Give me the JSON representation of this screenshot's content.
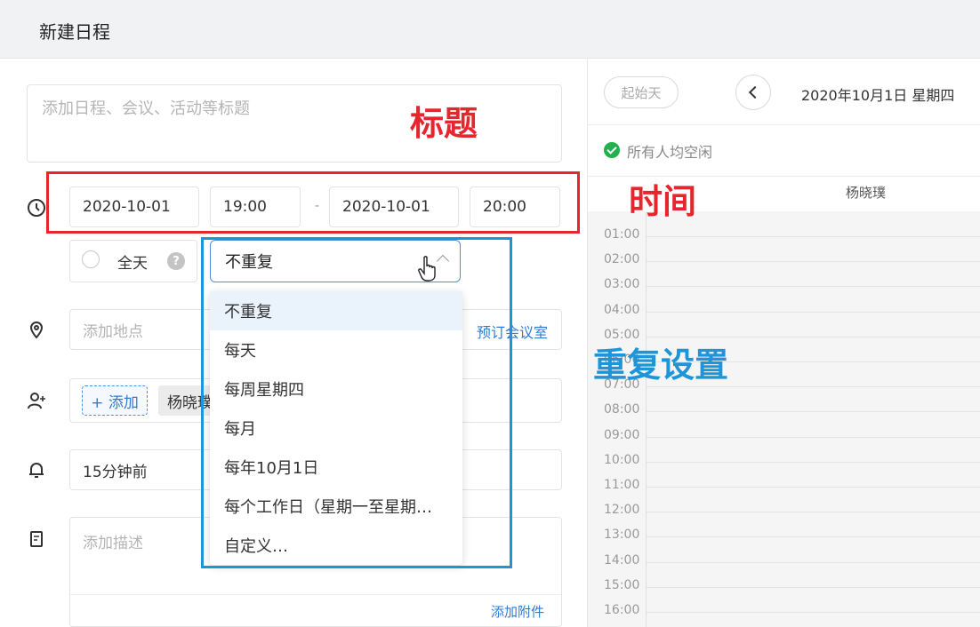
{
  "header": {
    "title": "新建日程"
  },
  "title_input": {
    "placeholder": "添加日程、会议、活动等标题"
  },
  "time": {
    "start_date": "2020-10-01",
    "start_time": "19:00",
    "separator": "-",
    "end_date": "2020-10-01",
    "end_time": "20:00",
    "all_day_label": "全天",
    "help_icon": "?"
  },
  "repeat": {
    "selected": "不重复",
    "options": [
      "不重复",
      "每天",
      "每周星期四",
      "每月",
      "每年10月1日",
      "每个工作日（星期一至星期…",
      "自定义…"
    ]
  },
  "location": {
    "placeholder": "添加地点",
    "book_room": "预订会议室"
  },
  "attendees": {
    "add_label": "+ 添加",
    "person": "杨晓璞"
  },
  "reminder": {
    "value": "15分钟前"
  },
  "description": {
    "placeholder": "添加描述",
    "attach_label": "添加附件"
  },
  "annotations": {
    "title": "标题",
    "time": "时间",
    "repeat": "重复设置"
  },
  "calendar": {
    "start_day": "起始天",
    "date": "2020年10月1日 星期四",
    "status": "所有人均空闲",
    "person": "杨晓璞",
    "hours": [
      "01:00",
      "02:00",
      "03:00",
      "04:00",
      "05:00",
      "06:00",
      "07:00",
      "08:00",
      "09:00",
      "10:00",
      "11:00",
      "12:00",
      "13:00",
      "14:00",
      "15:00",
      "16:00"
    ]
  },
  "colors": {
    "red_annotation": "#e5262d",
    "blue_annotation": "#1e95d8",
    "link": "#2f7bd6",
    "free_green": "#22b14c"
  }
}
